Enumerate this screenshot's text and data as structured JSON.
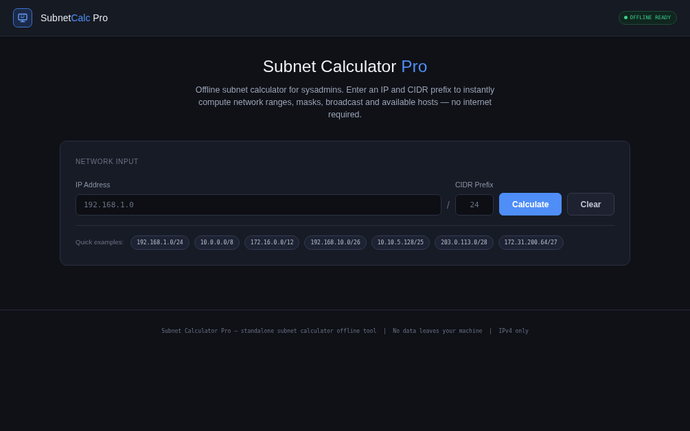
{
  "header": {
    "brand": [
      {
        "text": "Subnet",
        "accent": false
      },
      {
        "text": "Calc",
        "accent": true
      },
      {
        "text": " Pro",
        "accent": false
      }
    ],
    "status_badge": {
      "label": "OFFLINE READY"
    }
  },
  "hero": {
    "title": [
      {
        "text": "Subnet Calculator ",
        "accent": false
      },
      {
        "text": "Pro",
        "accent": true
      }
    ],
    "description": "Offline subnet calculator for sysadmins. Enter an IP and CIDR prefix to instantly compute network ranges, masks, broadcast and available hosts — no internet required."
  },
  "input_card": {
    "section_label": "NETWORK INPUT",
    "ip_field": {
      "label": "IP Address",
      "placeholder": "192.168.1.0"
    },
    "separator": "/",
    "cidr_field": {
      "label": "CIDR Prefix",
      "placeholder": "24"
    },
    "buttons": [
      {
        "label": "Calculate",
        "kind": "primary"
      },
      {
        "label": "Clear",
        "kind": "secondary"
      }
    ],
    "quick_examples": {
      "label": "Quick examples:",
      "items": [
        "192.168.1.0/24",
        "10.0.0.0/8",
        "172.16.0.0/12",
        "192.168.10.0/26",
        "10.10.5.128/25",
        "203.0.113.0/28",
        "172.31.200.64/27"
      ]
    }
  },
  "footer": {
    "text": "Subnet Calculator Pro — standalone subnet calculator offline tool  |  No data leaves your machine  |  IPv4 only"
  }
}
